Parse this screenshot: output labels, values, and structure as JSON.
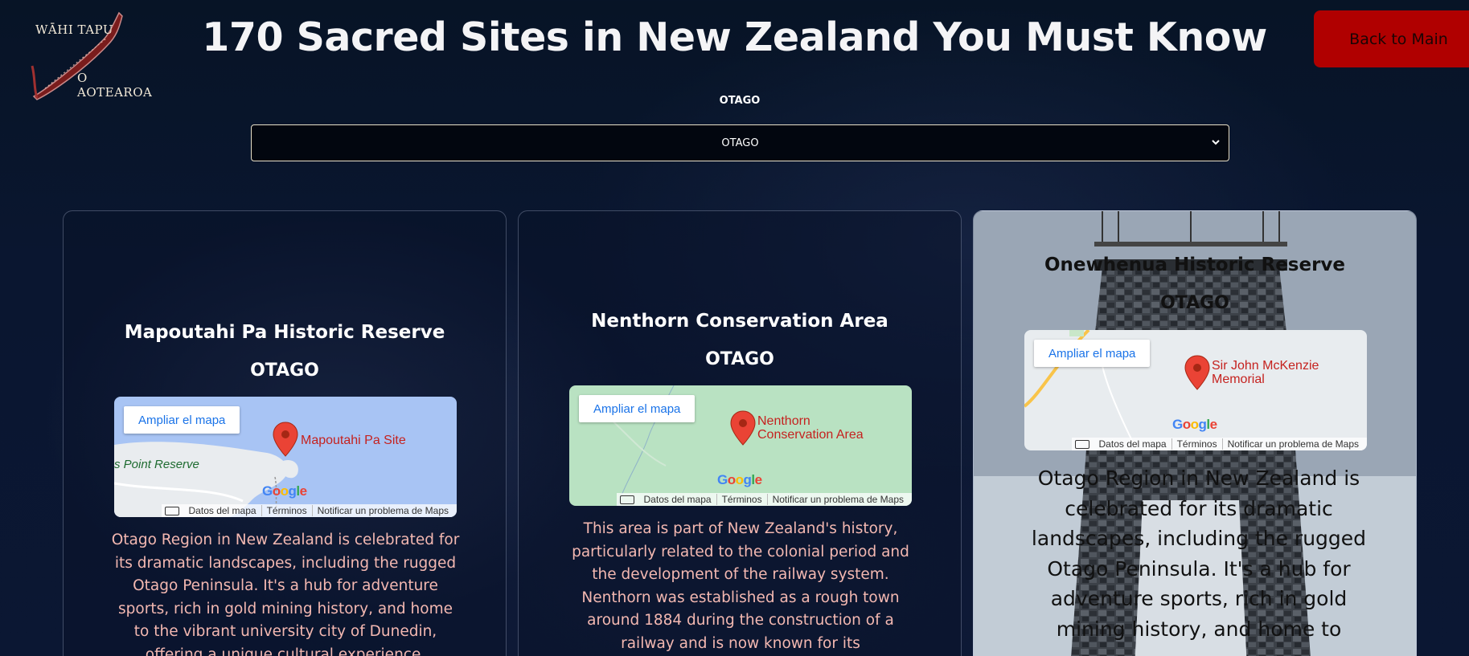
{
  "header": {
    "logo_line1": "WĀHI TAPU",
    "logo_line2": "O AOTEAROA",
    "title": "170 Sacred Sites in New Zealand You Must Know",
    "back_button": "Back to Main"
  },
  "filter": {
    "label": "OTAGO",
    "selected": "OTAGO"
  },
  "map_ui": {
    "expand": "Ampliar el mapa",
    "map_data": "Datos del mapa",
    "terms": "Términos",
    "report": "Notificar un problema de Maps",
    "google": "Google"
  },
  "cards": [
    {
      "title": "Mapoutahi Pa Historic Reserve",
      "region": "OTAGO",
      "map_label": "Mapoutahi Pa Site",
      "map_place": "s Point Reserve",
      "description": "Otago Region in New Zealand is celebrated for its dramatic landscapes, including the rugged Otago Peninsula. It's a hub for adventure sports, rich in gold mining history, and home to the vibrant university city of Dunedin, offering a unique cultural experience."
    },
    {
      "title": "Nenthorn Conservation Area",
      "region": "OTAGO",
      "map_label_1": "Nenthorn",
      "map_label_2": "Conservation Area",
      "description": "This area is part of New Zealand's history, particularly related to the colonial period and the development of the railway system. Nenthorn was established as a rough town around 1884 during the construction of a railway and is now known for its"
    },
    {
      "title": "Onewhenua Historic Reserve",
      "region": "OTAGO",
      "map_label_1": "Sir John McKenzie",
      "map_label_2": "Memorial",
      "description": "Otago Region in New Zealand is celebrated for its dramatic landscapes, including the rugged Otago Peninsula. It's a hub for adventure sports, rich in gold mining history, and home to"
    }
  ]
}
